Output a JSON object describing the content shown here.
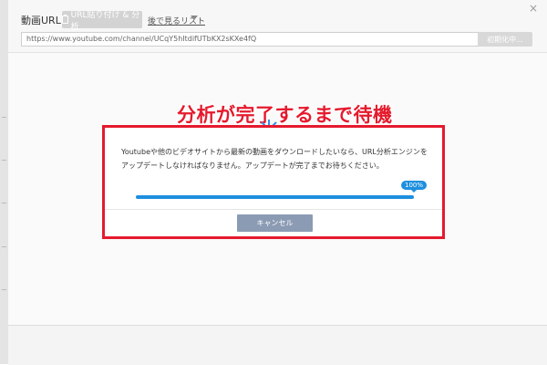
{
  "toolbar": {
    "url_label": "動画URL:",
    "paste_button": "URL貼り付け & 分析",
    "later_list": "後で見るリスト",
    "url_value": "https://www.youtube.com/channel/UCqY5hItdifUTbKX2sKXe4fQ",
    "analyze_button": "初期化中...",
    "close": "×"
  },
  "annotation": {
    "title": "分析が完了するまで待機",
    "color": "#e51a2d"
  },
  "dialog": {
    "message": "Youtubeや他のビデオサイトから最新の動画をダウンロードしたいなら、URL分析エンジンをアップデートしなければなりません。アップデートが完了までお待ちください。",
    "progress": 1.0,
    "progress_label": "100%",
    "cancel_button": "キャンセル",
    "accent": "#1e8fde"
  }
}
